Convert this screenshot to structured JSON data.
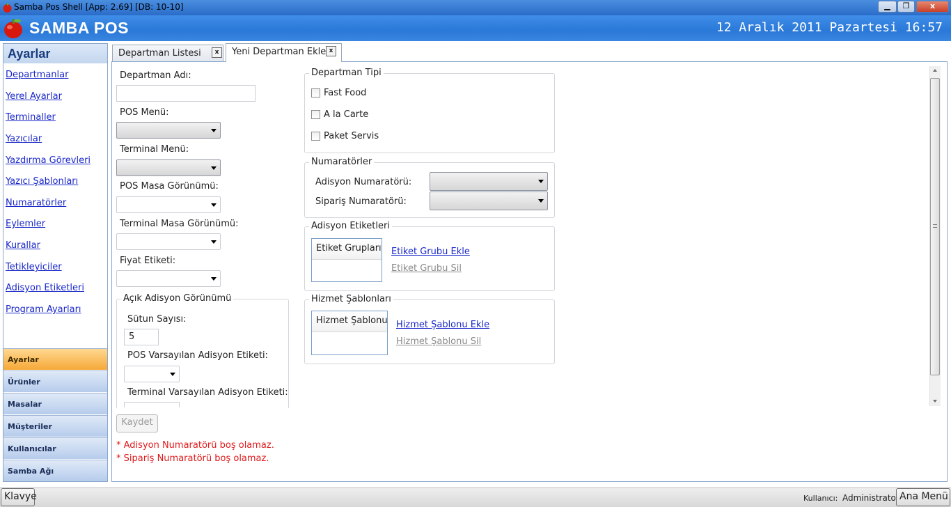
{
  "window": {
    "title": "Samba Pos Shell [App: 2.69] [DB: 10-10]",
    "min_label": "▁",
    "max_label": "❐",
    "close_label": "x"
  },
  "header": {
    "brand": "SAMBA POS",
    "datetime": "12 Aralık 2011 Pazartesi 16:57"
  },
  "sidebar": {
    "title": "Ayarlar",
    "links": [
      "Departmanlar",
      "Yerel Ayarlar",
      "Terminaller",
      "Yazıcılar",
      "Yazdırma Görevleri",
      "Yazıcı Şablonları",
      "Numaratörler",
      "Eylemler",
      "Kurallar",
      "Tetikleyiciler",
      "Adisyon Etiketleri",
      "Program Ayarları"
    ],
    "nav": [
      "Ayarlar",
      "Ürünler",
      "Masalar",
      "Müşteriler",
      "Kullanıcılar",
      "Samba Ağı"
    ],
    "active_nav": "Ayarlar"
  },
  "tabs": [
    {
      "label": "Departman Listesi",
      "close": "x"
    },
    {
      "label": "Yeni Departman Ekle",
      "close": "x"
    }
  ],
  "form": {
    "dept_name_label": "Departman Adı:",
    "dept_name_value": "",
    "pos_menu_label": "POS Menü:",
    "terminal_menu_label": "Terminal Menü:",
    "pos_table_view_label": "POS Masa Görünümü:",
    "terminal_table_view_label": "Terminal Masa Görünümü:",
    "price_tag_label": "Fiyat Etiketi:",
    "open_ticket_group": "Açık Adisyon Görünümü",
    "column_count_label": "Sütun Sayısı:",
    "column_count_value": "5",
    "pos_default_tag_label": "POS Varsayılan Adisyon Etiketi:",
    "terminal_default_tag_label": "Terminal Varsayılan Adisyon Etiketi:",
    "save_label": "Kaydet"
  },
  "dept_type": {
    "title": "Departman Tipi",
    "options": [
      "Fast Food",
      "A la Carte",
      "Paket Servis"
    ]
  },
  "numerators": {
    "title": "Numaratörler",
    "ticket_label": "Adisyon Numaratörü:",
    "order_label": "Sipariş Numaratörü:"
  },
  "ticket_tags": {
    "title": "Adisyon Etiketleri",
    "list_header": "Etiket Grupları",
    "add_link": "Etiket Grubu Ekle",
    "remove_link": "Etiket Grubu Sil"
  },
  "service_templates": {
    "title": "Hizmet Şablonları",
    "list_header": "Hizmet Şablonu",
    "add_link": "Hizmet Şablonu Ekle",
    "remove_link": "Hizmet Şablonu Sil"
  },
  "errors": [
    "* Adisyon Numaratörü boş olamaz.",
    "* Sipariş Numaratörü boş olamaz."
  ],
  "bottom": {
    "keyboard_label": "Klavye",
    "user_label": "Kullanıcı:",
    "user_name": "Administrator",
    "main_menu_label": "Ana Menü"
  }
}
